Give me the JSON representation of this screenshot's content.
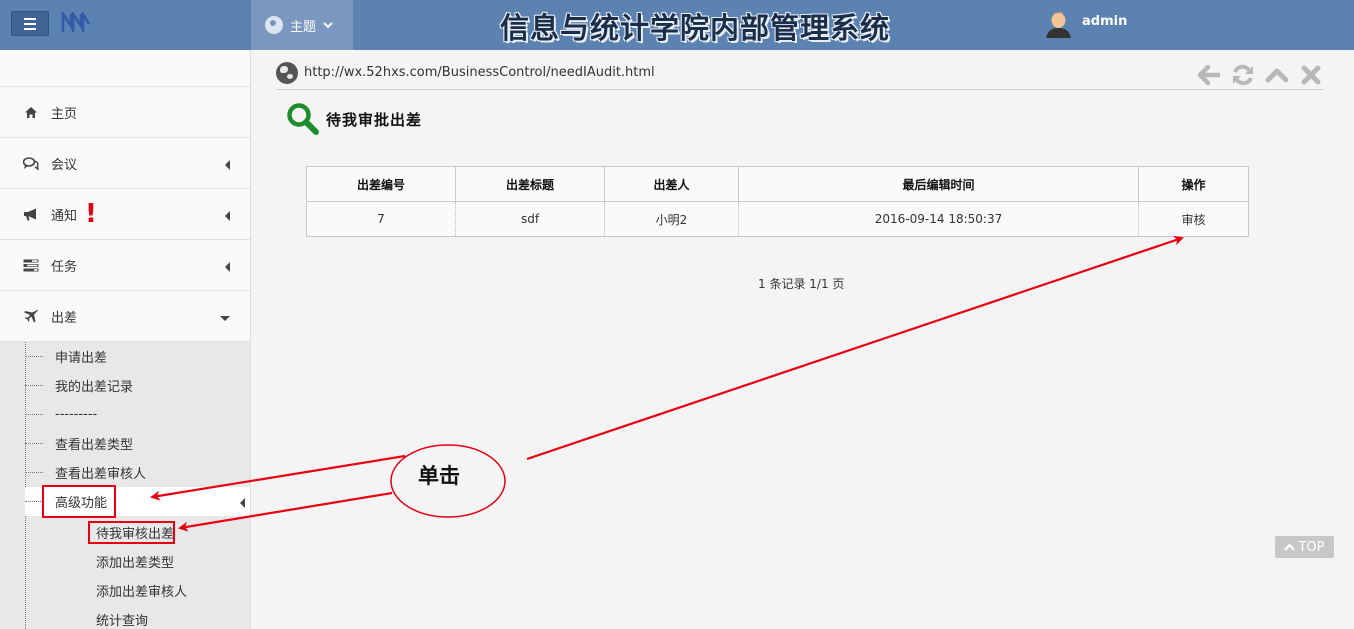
{
  "header": {
    "theme_label": "主题",
    "app_title": "信息与统计学院内部管理系统",
    "username": "admin"
  },
  "sidebar": {
    "items": [
      {
        "label": "主页",
        "icon": "home-icon"
      },
      {
        "label": "会议",
        "icon": "comments-icon"
      },
      {
        "label": "通知",
        "icon": "bullhorn-icon",
        "alert": "!"
      },
      {
        "label": "任务",
        "icon": "tasks-icon"
      },
      {
        "label": "出差",
        "icon": "plane-icon"
      }
    ],
    "travel_sub": [
      "申请出差",
      "我的出差记录",
      "---------",
      "查看出差类型",
      "查看出差审核人",
      "高级功能"
    ],
    "advanced_sub": [
      "待我审核出差",
      "添加出差类型",
      "添加出差审核人",
      "统计查询"
    ]
  },
  "main": {
    "url": "http://wx.52hxs.com/BusinessControl/needIAudit.html",
    "heading": "待我审批出差",
    "table": {
      "headers": [
        "出差编号",
        "出差标题",
        "出差人",
        "最后编辑时间",
        "操作"
      ],
      "rows": [
        [
          "7",
          "sdf",
          "小明2",
          "2016-09-14 18:50:37",
          "审核"
        ]
      ]
    },
    "pager": "1 条记录 1/1 页",
    "top_button": "TOP"
  },
  "annotation": {
    "label": "单击",
    "color": "#e60012"
  },
  "colors": {
    "header_bg": "#5b82b1",
    "accent_red": "#e60012",
    "search_green": "#1d8c2c"
  }
}
